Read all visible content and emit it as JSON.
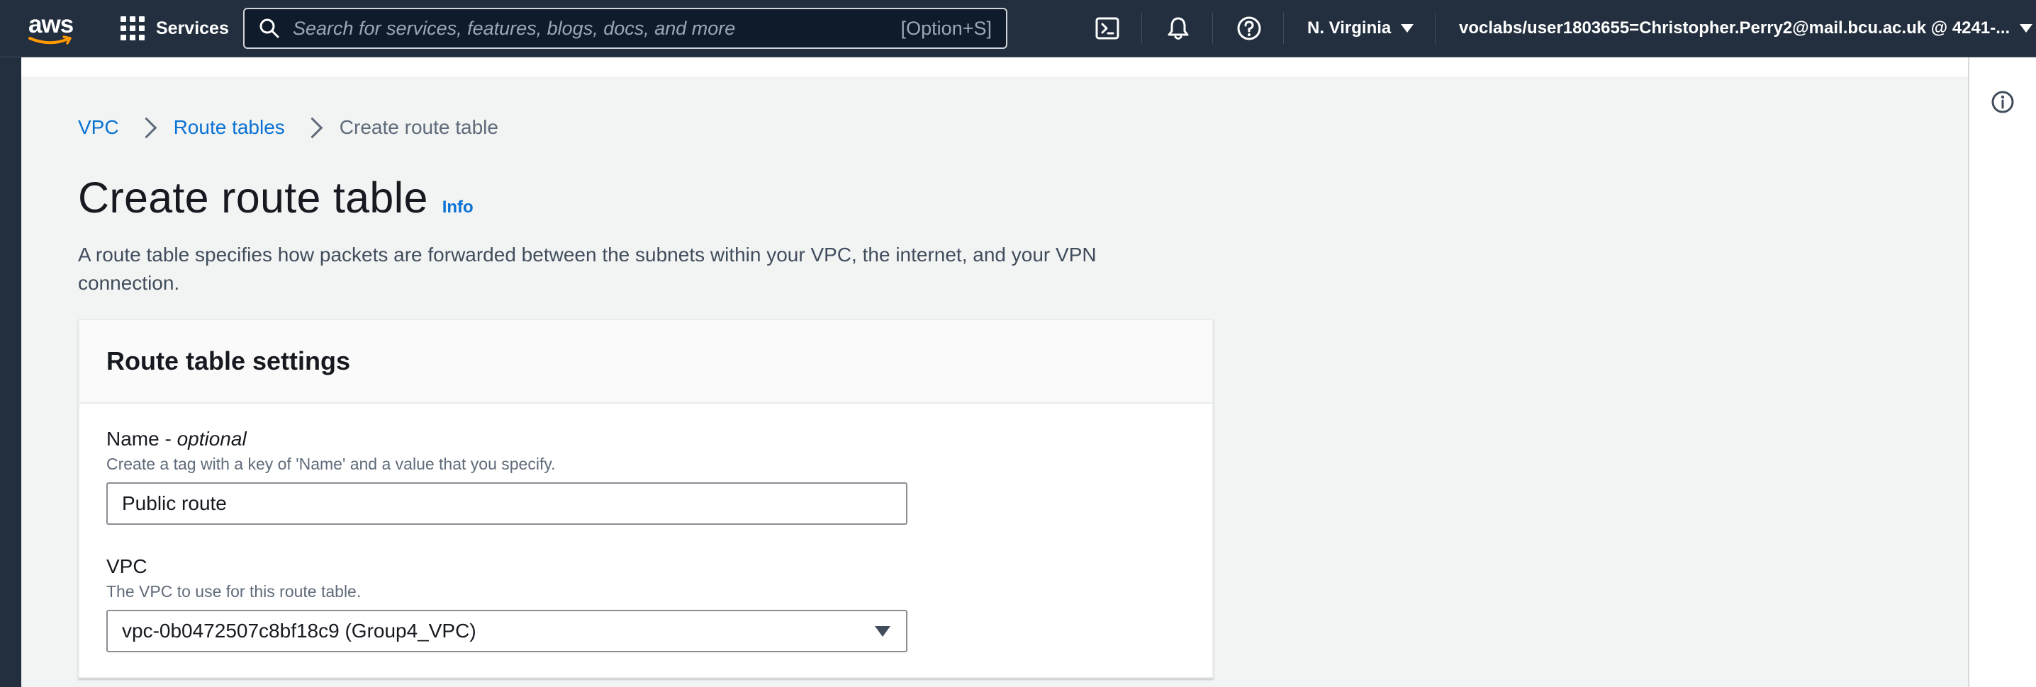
{
  "nav": {
    "logo_text": "aws",
    "services_label": "Services",
    "search_placeholder": "Search for services, features, blogs, docs, and more",
    "search_shortcut": "[Option+S]",
    "region": "N. Virginia",
    "account": "voclabs/user1803655=Christopher.Perry2@mail.bcu.ac.uk @ 4241-..."
  },
  "breadcrumb": {
    "items": [
      "VPC",
      "Route tables"
    ],
    "current": "Create route table"
  },
  "page": {
    "title": "Create route table",
    "info_link": "Info",
    "description": "A route table specifies how packets are forwarded between the subnets within your VPC, the internet, and your VPN connection."
  },
  "panel": {
    "title": "Route table settings",
    "name_field": {
      "label": "Name - ",
      "label_optional": "optional",
      "hint": "Create a tag with a key of 'Name' and a value that you specify.",
      "value": "Public route"
    },
    "vpc_field": {
      "label": "VPC",
      "hint": "The VPC to use for this route table.",
      "selected": "vpc-0b0472507c8bf18c9 (Group4_VPC)"
    }
  },
  "colors": {
    "nav_bg": "#232f3e",
    "link": "#0972d3",
    "page_bg": "#f2f3f3",
    "aws_smile": "#ff9900"
  }
}
